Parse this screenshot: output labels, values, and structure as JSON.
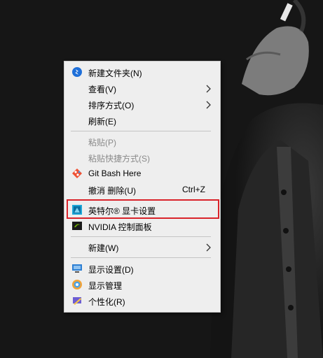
{
  "menu": {
    "items": [
      {
        "id": "new-folder",
        "label": "新建文件夹(N)",
        "icon": "new-folder-icon"
      },
      {
        "id": "view",
        "label": "查看(V)",
        "submenu": true
      },
      {
        "id": "sort",
        "label": "排序方式(O)",
        "submenu": true
      },
      {
        "id": "refresh",
        "label": "刷新(E)"
      },
      {
        "id": "paste",
        "label": "粘贴(P)",
        "disabled": true
      },
      {
        "id": "paste-shortcut",
        "label": "粘贴快捷方式(S)",
        "disabled": true
      },
      {
        "id": "git-bash",
        "label": "Git Bash Here",
        "icon": "git-icon"
      },
      {
        "id": "undo-delete",
        "label": "撤消 删除(U)",
        "shortcut": "Ctrl+Z"
      },
      {
        "id": "intel-graphics",
        "label": "英特尔® 显卡设置",
        "icon": "intel-graphics-icon"
      },
      {
        "id": "nvidia",
        "label": "NVIDIA 控制面板",
        "icon": "nvidia-icon"
      },
      {
        "id": "new",
        "label": "新建(W)",
        "submenu": true
      },
      {
        "id": "display-settings",
        "label": "显示设置(D)",
        "icon": "display-icon"
      },
      {
        "id": "display-manage",
        "label": "显示管理",
        "icon": "display-manage-icon"
      },
      {
        "id": "personalize",
        "label": "个性化(R)",
        "icon": "personalize-icon"
      }
    ]
  },
  "colors": {
    "menu_bg": "#eeeeee",
    "highlight_border": "#d9232a",
    "disabled_text": "#8a8a8a"
  }
}
